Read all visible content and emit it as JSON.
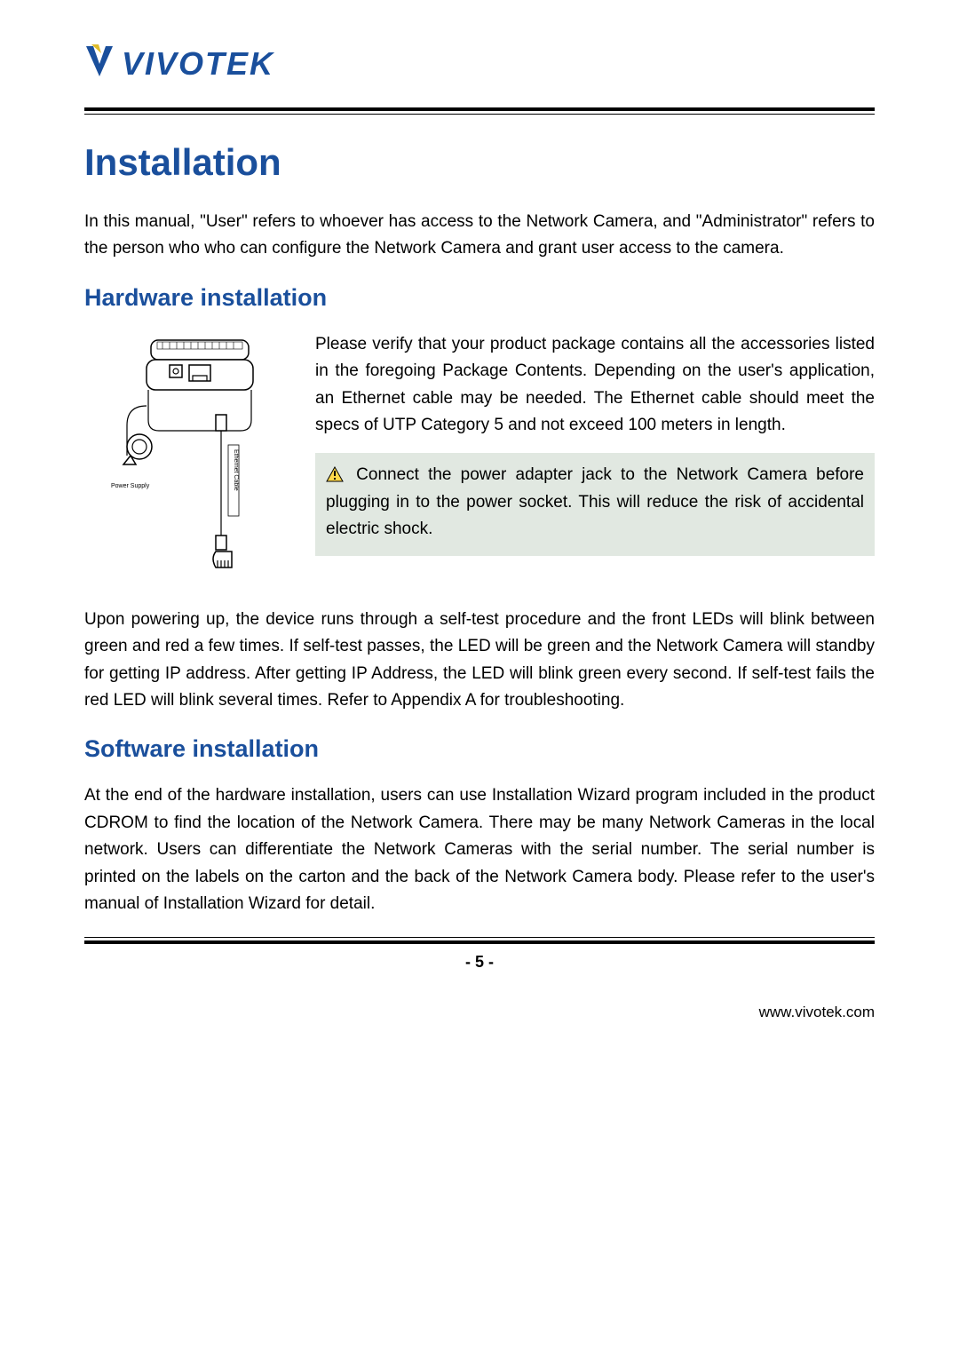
{
  "logo": {
    "text": "VIVOTEK"
  },
  "title": "Installation",
  "intro": "In this manual, \"User\" refers to whoever has access to the Network Camera, and \"Administrator\" refers to the person who who can configure the Network Camera and grant user access to the camera.",
  "hardware": {
    "heading": "Hardware installation",
    "para1": "Please verify that your product package contains all the accessories listed in the foregoing Package Contents. Depending on the user's application, an Ethernet cable may be needed. The Ethernet cable should meet the specs of UTP Category 5 and not exceed 100 meters in length.",
    "callout": "Connect the power adapter jack to the Network Camera before plugging in to the power socket. This will reduce the risk of accidental electric shock.",
    "para2": "Upon powering up, the device runs through a self-test procedure and the front LEDs will blink between green and red a few times.  If self-test passes, the LED will be green and the Network Camera will standby for getting IP address. After getting IP Address, the LED will blink green every second. If self-test fails the red LED will blink several times. Refer to Appendix A for troubleshooting.",
    "figure": {
      "label_power": "Power Supply",
      "label_eth": "Ethernet Cable"
    }
  },
  "software": {
    "heading": "Software installation",
    "para": "At the end of the hardware installation, users can use Installation Wizard program included in the product CDROM to find the location of the Network Camera. There may be many Network Cameras in the local network. Users can differentiate the Network Cameras with the serial number. The serial number is printed on the labels on the carton and the back of the Network Camera body. Please refer to the user's manual of Installation Wizard for detail."
  },
  "page_number": "- 5 -",
  "footer_url": "www.vivotek.com",
  "icons": {
    "warning": "warning-triangle-icon"
  }
}
